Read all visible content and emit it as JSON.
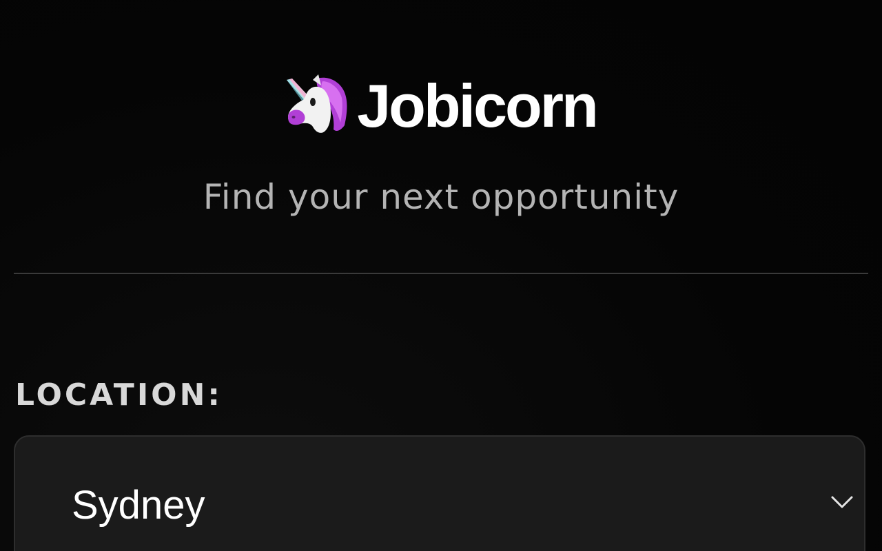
{
  "brand": {
    "name": "Jobicorn",
    "logo_icon": "unicorn-icon",
    "tagline": "Find your next opportunity"
  },
  "location": {
    "label": "LOCATION:",
    "selected": "Sydney",
    "icon": "chevron-down-icon"
  },
  "colors": {
    "background": "#050505",
    "text_primary": "#ffffff",
    "text_secondary": "#b4b4b4",
    "divider": "#3a3a3a",
    "field_background": "#1b1b1b",
    "unicorn_mane": "#b13fd6"
  }
}
